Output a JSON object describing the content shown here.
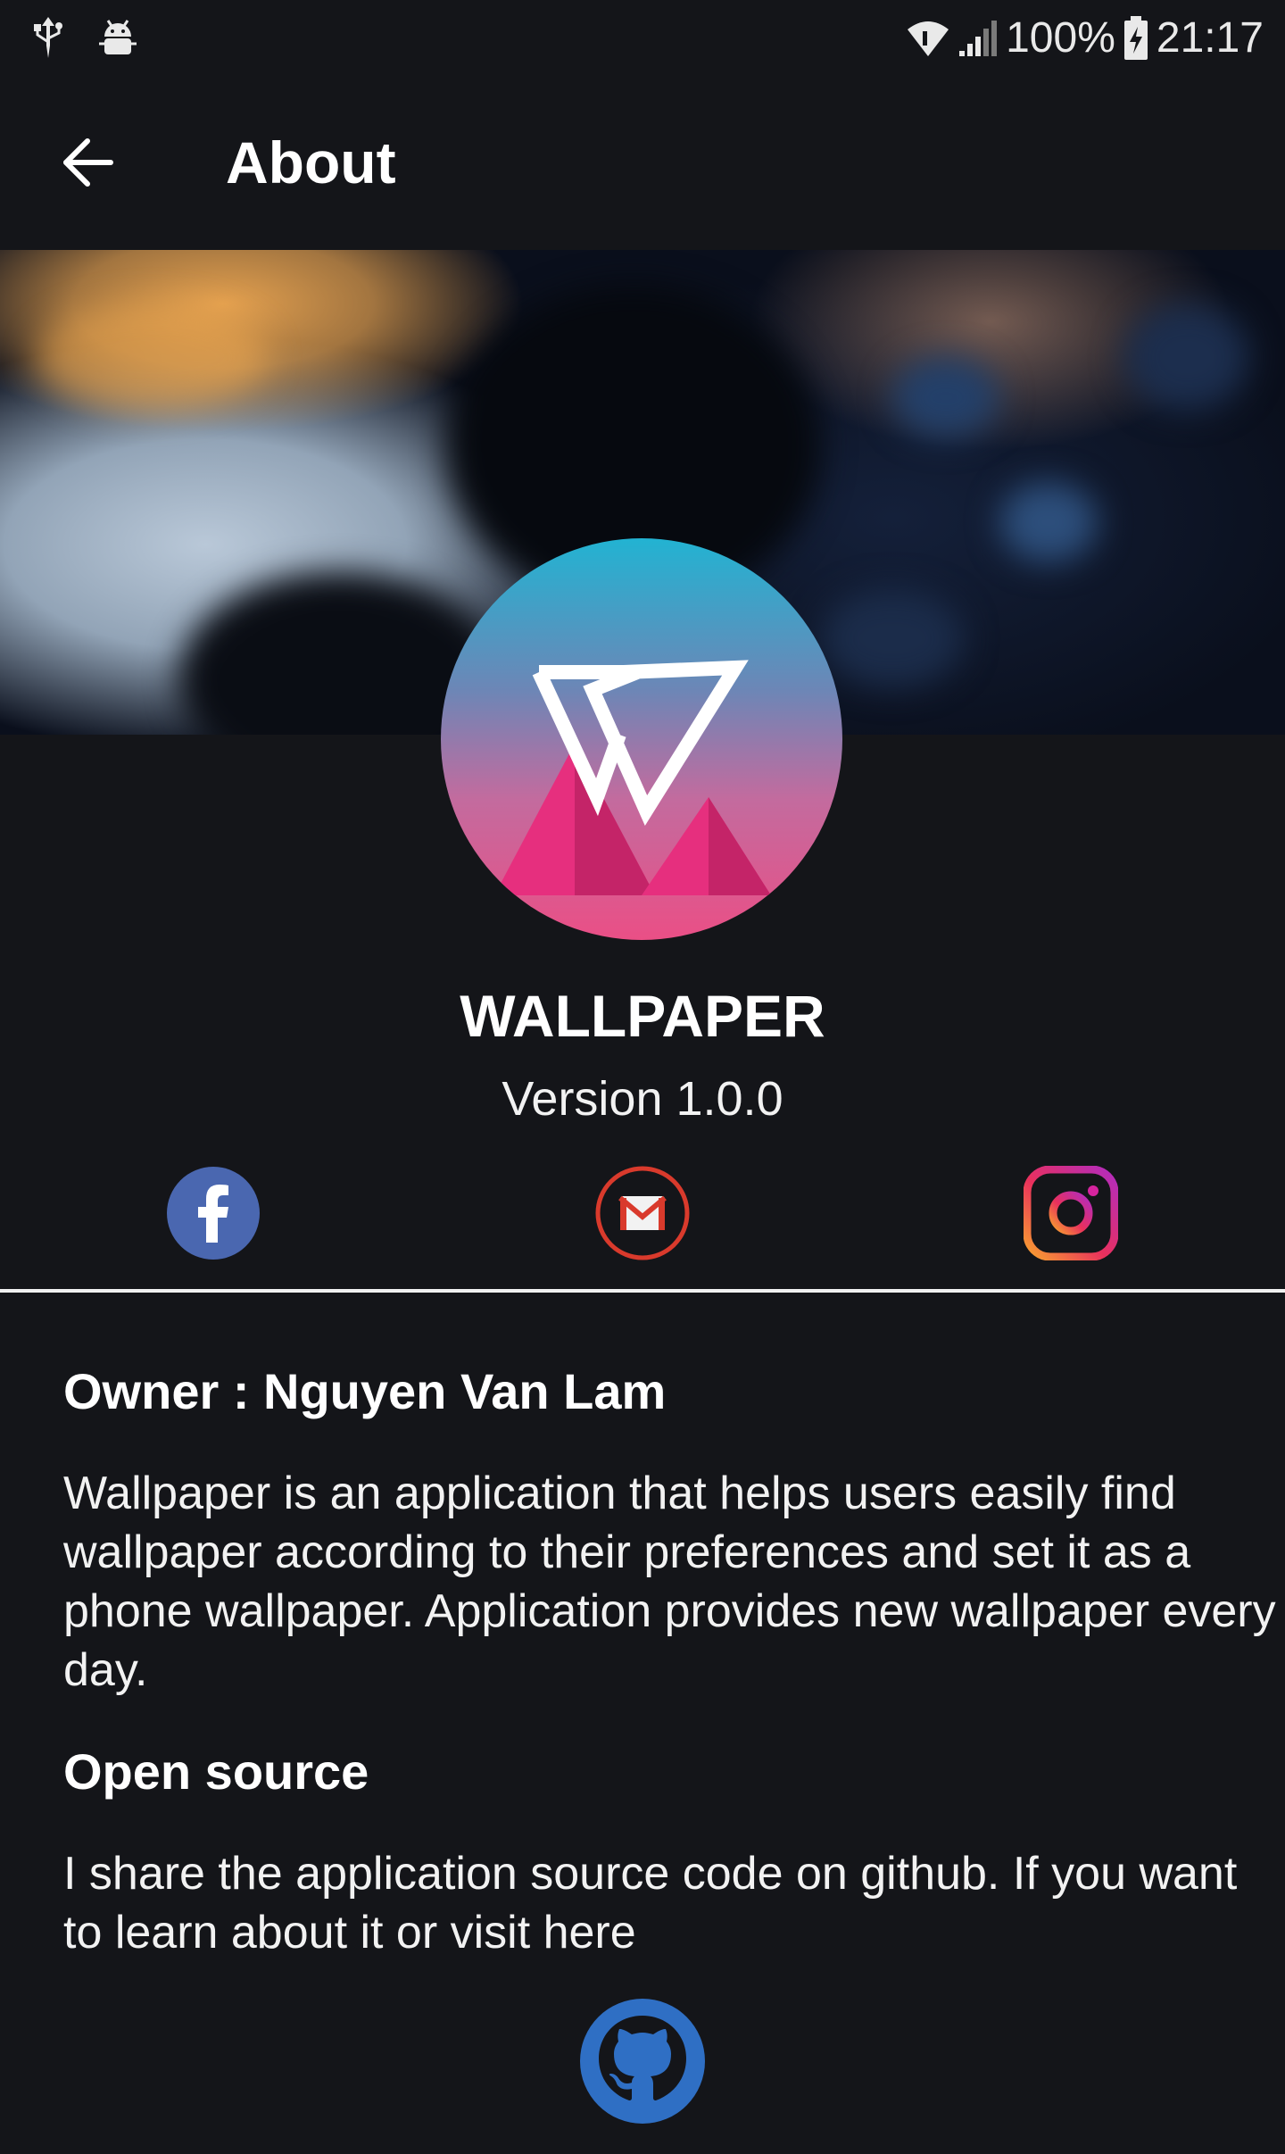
{
  "status_bar": {
    "battery": "100%",
    "time": "21:17",
    "icons": [
      "usb-icon",
      "android-debug-icon",
      "wifi-icon",
      "signal-icon",
      "battery-charging-icon"
    ]
  },
  "app_bar": {
    "title": "About",
    "back_icon": "arrow-back-icon"
  },
  "app": {
    "name": "WALLPAPER",
    "version": "Version 1.0.0"
  },
  "social": {
    "items": [
      "facebook-icon",
      "gmail-icon",
      "instagram-icon"
    ],
    "colors": {
      "facebook": "#4a67b0",
      "gmail": "#d93a2c",
      "instagram": "#d6249f"
    }
  },
  "about": {
    "owner": "Owner : Nguyen Van Lam",
    "description": "Wallpaper is an application that helps users easily find wallpaper according to their preferences and set it as a phone wallpaper. Application provides new wallpaper every day.",
    "open_source_title": "Open source",
    "open_source_text": "I share the application source code on github. If you want to learn about it or visit here",
    "github_icon": "github-icon"
  },
  "colors": {
    "background": "#141519",
    "github": "#2f6fc4",
    "logo_gradient": [
      "#22b3d2",
      "#ea4f86"
    ]
  }
}
